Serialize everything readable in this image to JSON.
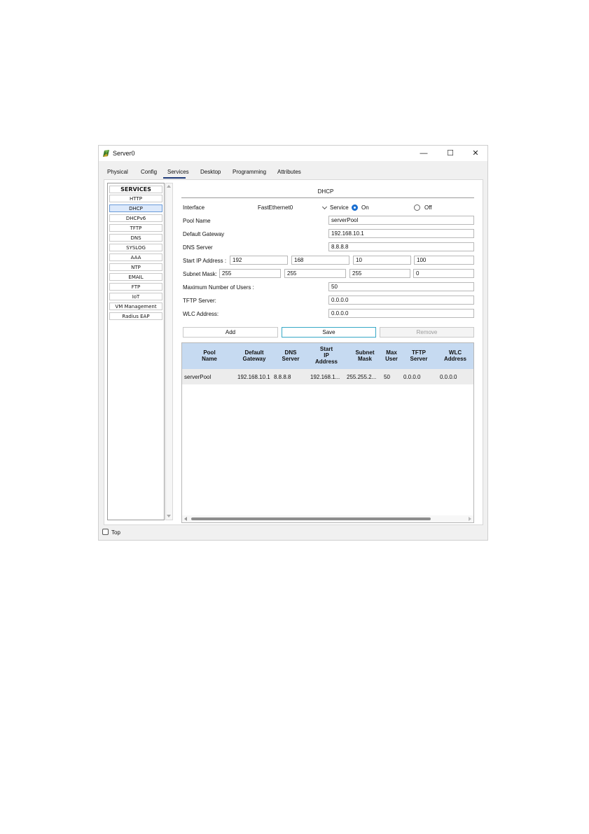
{
  "window": {
    "title": "Server0",
    "controls": {
      "minimize": "—",
      "maximize": "☐",
      "close": "✕"
    }
  },
  "tabs": [
    {
      "label": "Physical"
    },
    {
      "label": "Config"
    },
    {
      "label": "Services",
      "active": true
    },
    {
      "label": "Desktop"
    },
    {
      "label": "Programming"
    },
    {
      "label": "Attributes"
    }
  ],
  "services": {
    "header": "SERVICES",
    "items": [
      "HTTP",
      "DHCP",
      "DHCPv6",
      "TFTP",
      "DNS",
      "SYSLOG",
      "AAA",
      "NTP",
      "EMAIL",
      "FTP",
      "IoT",
      "VM Management",
      "Radius EAP"
    ],
    "selected": "DHCP"
  },
  "dhcp": {
    "title": "DHCP",
    "interface_label": "Interface",
    "interface_value": "FastEthernet0",
    "service_label": "Service",
    "on_label": "On",
    "off_label": "Off",
    "service_state": "On",
    "pool_name_label": "Pool Name",
    "pool_name": "serverPool",
    "default_gateway_label": "Default Gateway",
    "default_gateway": "192.168.10.1",
    "dns_server_label": "DNS Server",
    "dns_server": "8.8.8.8",
    "start_ip_label": "Start IP Address :",
    "start_ip": [
      "192",
      "168",
      "10",
      "100"
    ],
    "subnet_mask_label": "Subnet Mask:",
    "subnet_mask": [
      "255",
      "255",
      "255",
      "0"
    ],
    "max_users_label": "Maximum Number of Users :",
    "max_users": "50",
    "tftp_server_label": "TFTP Server:",
    "tftp_server": "0.0.0.0",
    "wlc_address_label": "WLC Address:",
    "wlc_address": "0.0.0.0",
    "buttons": {
      "add": "Add",
      "save": "Save",
      "remove": "Remove"
    }
  },
  "table": {
    "columns": [
      "Pool\nName",
      "Default\nGateway",
      "DNS\nServer",
      "Start\nIP\nAddress",
      "Subnet\nMask",
      "Max\nUser",
      "TFTP\nServer",
      "WLC\nAddress"
    ],
    "rows": [
      [
        "serverPool",
        "192.168.10.1",
        "8.8.8.8",
        "192.168.1...",
        "255.255.2...",
        "50",
        "0.0.0.0",
        "0.0.0.0"
      ]
    ]
  },
  "footer": {
    "top_label": "Top",
    "top_checked": false
  },
  "colors": {
    "accent": "#1a6fd1",
    "table_header": "#c6daf1",
    "tab_underline": "#1f3b7a"
  },
  "icons": {
    "app": "server-app-icon"
  }
}
